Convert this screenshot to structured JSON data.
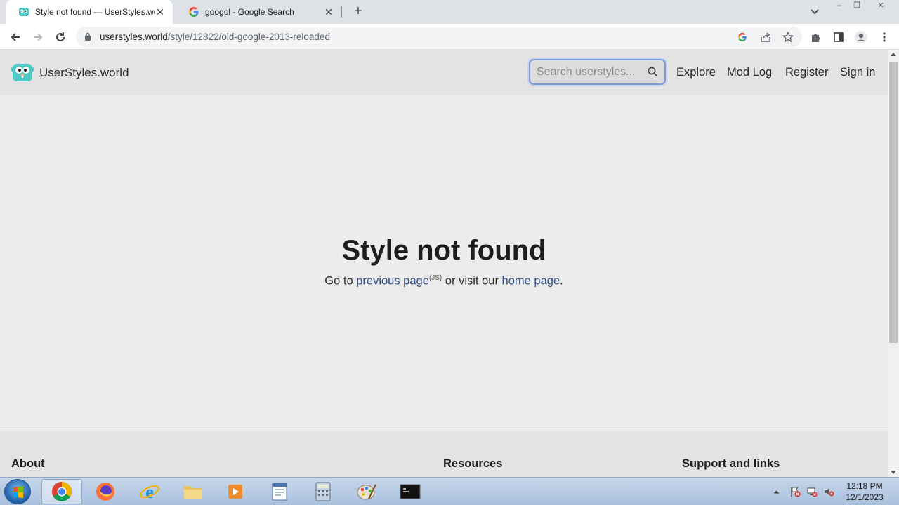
{
  "browser": {
    "tabs": [
      {
        "title": "Style not found — UserStyles.world",
        "close": "✕"
      },
      {
        "title": "googol - Google Search",
        "close": "✕"
      }
    ],
    "new_tab": "+",
    "window_controls": {
      "minimize": "–",
      "maximize": "❐",
      "close": "✕"
    },
    "url_host": "userstyles.world",
    "url_path": "/style/12822/old-google-2013-reloaded"
  },
  "header": {
    "brand": "UserStyles.world",
    "search_placeholder": "Search userstyles...",
    "nav": [
      "Explore",
      "Mod Log",
      "Register",
      "Sign in"
    ]
  },
  "main": {
    "title": "Style not found",
    "text_before": "Go to ",
    "previous_link": "previous page",
    "js_note": "(JS)",
    "text_middle": " or visit our ",
    "home_link": "home page",
    "text_after": "."
  },
  "footer": {
    "headings": [
      "About",
      "Resources",
      "Support and links"
    ]
  },
  "taskbar": {
    "time": "12:18 PM",
    "date": "12/1/2023"
  },
  "colors": {
    "link": "#2e4c85",
    "page_bg": "#ececec",
    "header_bg": "#e3e3e3"
  }
}
